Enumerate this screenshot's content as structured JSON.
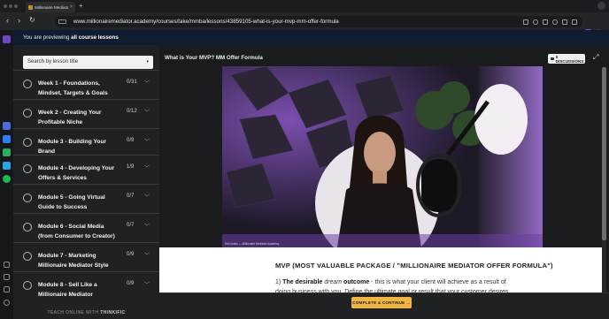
{
  "browser": {
    "tab_title": "Millionaire Mediator Bus",
    "tab_close": "×",
    "new_tab": "+",
    "back": "‹",
    "forward": "›",
    "reload": "↻",
    "url": "www.millionairemediator.academy/courses/take/mmba/lessons/43859105-what-is-your-mvp-mm-offer-formula"
  },
  "banner": {
    "prefix": "You are previewing ",
    "bold": "all course lessons"
  },
  "sidebar": {
    "search_placeholder": "Search by lesson title",
    "caret": "▾",
    "items": [
      {
        "title": "Week 1 - Foundations, Mindset, Targets & Goals",
        "count": "0/31"
      },
      {
        "title": "Week 2 - Creating Your Profitable Niche",
        "count": "0/12"
      },
      {
        "title": "Module 3 - Building Your Brand",
        "count": "0/9"
      },
      {
        "title": "Module 4 - Developing Your Offers & Services",
        "count": "1/9"
      },
      {
        "title": "Module 5 - Going Virtual Guide to Success",
        "count": "0/7"
      },
      {
        "title": "Module 6 - Social Media (from Consumer to Creator)",
        "count": "0/7"
      },
      {
        "title": "Module 7 - Marketing Millionaire Mediator Style",
        "count": "0/9"
      },
      {
        "title": "Module 8 - Sell Like a Millionaire Mediator",
        "count": "0/9"
      }
    ],
    "footer_prefix": "TEACH ONLINE WITH ",
    "footer_brand": "THINKIFIC"
  },
  "main": {
    "lesson_title": "What is Your MVP? MM Offer Formula",
    "discussions_label": "0 DISCUSSIONS",
    "expand": "⤢",
    "video_caption": "Kiri Linnitz — Millionaire Mediator Academy",
    "heading": "MVP (MOST VALUABLE PACKAGE / \"MILLIONAIRE MEDIATOR OFFER FORMULA\")",
    "para_num": "1) ",
    "para_bold": "The desirable ",
    "para_em": "dream",
    "para_bold2": " outcome",
    "para_rest": " - this is what your client will achieve as a result of",
    "para_line2": "doing business with you. Define the ultimate goal or result that your customer desires",
    "cta": "COMPLETE & CONTINUE →"
  },
  "colors": {
    "accent": "#f0b643",
    "banner": "#101c32",
    "sidebar": "#202123",
    "video_purple": "#a872e0"
  }
}
